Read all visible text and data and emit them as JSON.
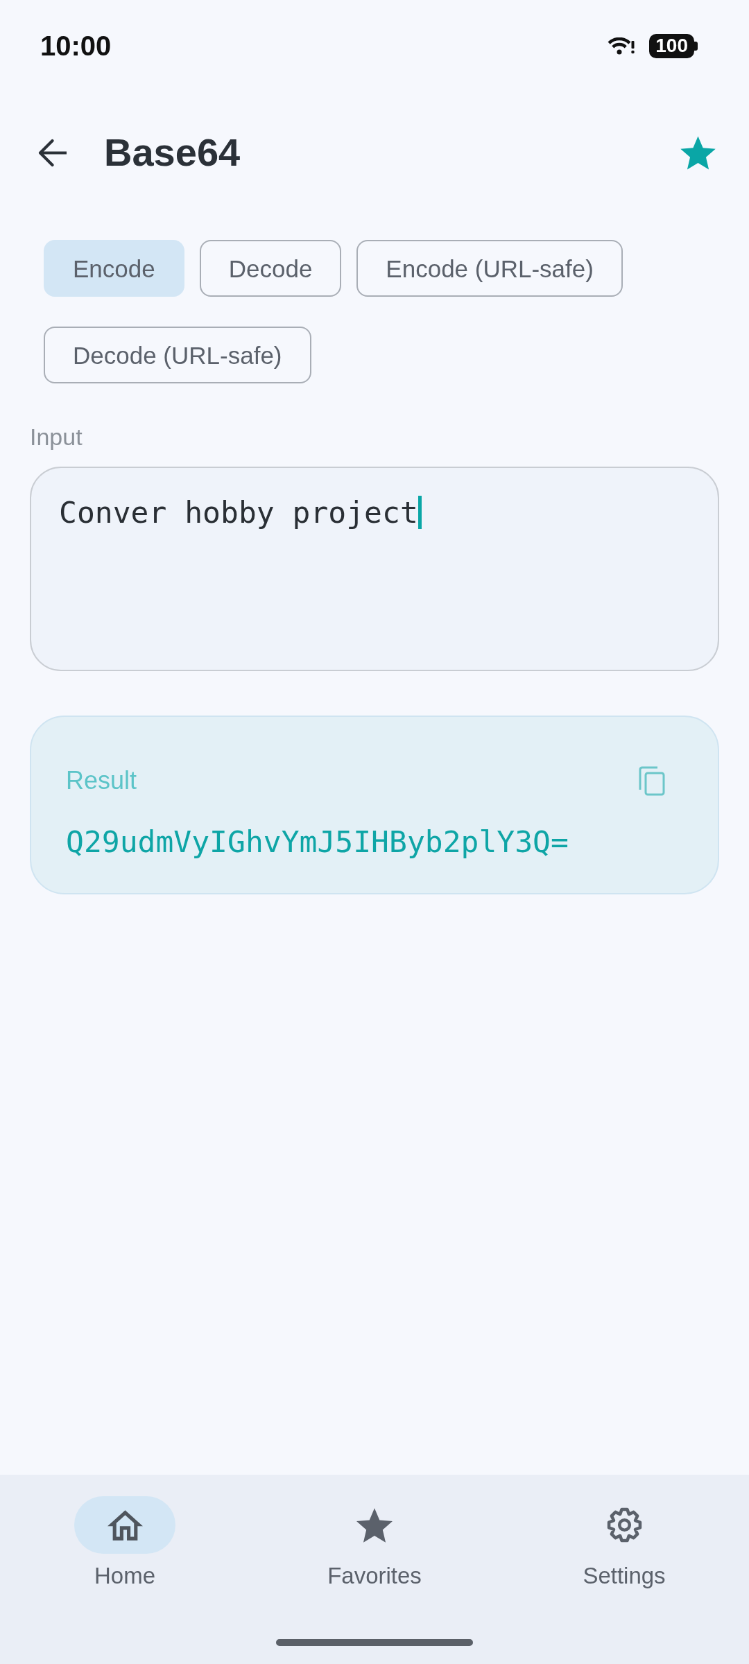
{
  "status_bar": {
    "time": "10:00",
    "battery": "100"
  },
  "header": {
    "title": "Base64",
    "favorite": true
  },
  "modes": [
    {
      "label": "Encode",
      "selected": true
    },
    {
      "label": "Decode",
      "selected": false
    },
    {
      "label": "Encode (URL-safe)",
      "selected": false
    },
    {
      "label": "Decode (URL-safe)",
      "selected": false
    }
  ],
  "input": {
    "label": "Input",
    "value": "Conver hobby project",
    "focused": true
  },
  "result": {
    "label": "Result",
    "value": "Q29udmVyIGhvYmJ5IHByb2plY3Q="
  },
  "bottom_nav": [
    {
      "label": "Home",
      "selected": true
    },
    {
      "label": "Favorites",
      "selected": false
    },
    {
      "label": "Settings",
      "selected": false
    }
  ]
}
